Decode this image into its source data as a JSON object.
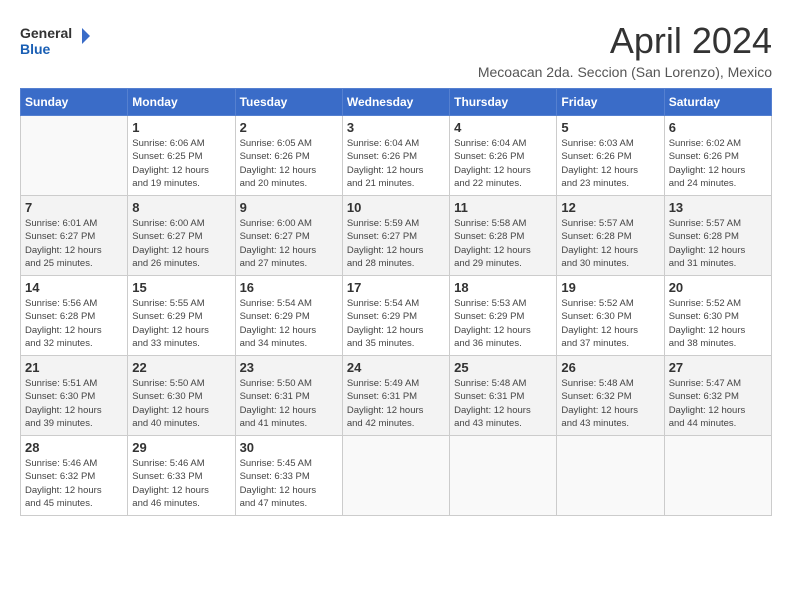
{
  "logo": {
    "line1": "General",
    "line2": "Blue"
  },
  "title": "April 2024",
  "subtitle": "Mecoacan 2da. Seccion (San Lorenzo), Mexico",
  "weekdays": [
    "Sunday",
    "Monday",
    "Tuesday",
    "Wednesday",
    "Thursday",
    "Friday",
    "Saturday"
  ],
  "weeks": [
    [
      {
        "day": "",
        "info": ""
      },
      {
        "day": "1",
        "info": "Sunrise: 6:06 AM\nSunset: 6:25 PM\nDaylight: 12 hours\nand 19 minutes."
      },
      {
        "day": "2",
        "info": "Sunrise: 6:05 AM\nSunset: 6:26 PM\nDaylight: 12 hours\nand 20 minutes."
      },
      {
        "day": "3",
        "info": "Sunrise: 6:04 AM\nSunset: 6:26 PM\nDaylight: 12 hours\nand 21 minutes."
      },
      {
        "day": "4",
        "info": "Sunrise: 6:04 AM\nSunset: 6:26 PM\nDaylight: 12 hours\nand 22 minutes."
      },
      {
        "day": "5",
        "info": "Sunrise: 6:03 AM\nSunset: 6:26 PM\nDaylight: 12 hours\nand 23 minutes."
      },
      {
        "day": "6",
        "info": "Sunrise: 6:02 AM\nSunset: 6:26 PM\nDaylight: 12 hours\nand 24 minutes."
      }
    ],
    [
      {
        "day": "7",
        "info": "Sunrise: 6:01 AM\nSunset: 6:27 PM\nDaylight: 12 hours\nand 25 minutes."
      },
      {
        "day": "8",
        "info": "Sunrise: 6:00 AM\nSunset: 6:27 PM\nDaylight: 12 hours\nand 26 minutes."
      },
      {
        "day": "9",
        "info": "Sunrise: 6:00 AM\nSunset: 6:27 PM\nDaylight: 12 hours\nand 27 minutes."
      },
      {
        "day": "10",
        "info": "Sunrise: 5:59 AM\nSunset: 6:27 PM\nDaylight: 12 hours\nand 28 minutes."
      },
      {
        "day": "11",
        "info": "Sunrise: 5:58 AM\nSunset: 6:28 PM\nDaylight: 12 hours\nand 29 minutes."
      },
      {
        "day": "12",
        "info": "Sunrise: 5:57 AM\nSunset: 6:28 PM\nDaylight: 12 hours\nand 30 minutes."
      },
      {
        "day": "13",
        "info": "Sunrise: 5:57 AM\nSunset: 6:28 PM\nDaylight: 12 hours\nand 31 minutes."
      }
    ],
    [
      {
        "day": "14",
        "info": "Sunrise: 5:56 AM\nSunset: 6:28 PM\nDaylight: 12 hours\nand 32 minutes."
      },
      {
        "day": "15",
        "info": "Sunrise: 5:55 AM\nSunset: 6:29 PM\nDaylight: 12 hours\nand 33 minutes."
      },
      {
        "day": "16",
        "info": "Sunrise: 5:54 AM\nSunset: 6:29 PM\nDaylight: 12 hours\nand 34 minutes."
      },
      {
        "day": "17",
        "info": "Sunrise: 5:54 AM\nSunset: 6:29 PM\nDaylight: 12 hours\nand 35 minutes."
      },
      {
        "day": "18",
        "info": "Sunrise: 5:53 AM\nSunset: 6:29 PM\nDaylight: 12 hours\nand 36 minutes."
      },
      {
        "day": "19",
        "info": "Sunrise: 5:52 AM\nSunset: 6:30 PM\nDaylight: 12 hours\nand 37 minutes."
      },
      {
        "day": "20",
        "info": "Sunrise: 5:52 AM\nSunset: 6:30 PM\nDaylight: 12 hours\nand 38 minutes."
      }
    ],
    [
      {
        "day": "21",
        "info": "Sunrise: 5:51 AM\nSunset: 6:30 PM\nDaylight: 12 hours\nand 39 minutes."
      },
      {
        "day": "22",
        "info": "Sunrise: 5:50 AM\nSunset: 6:30 PM\nDaylight: 12 hours\nand 40 minutes."
      },
      {
        "day": "23",
        "info": "Sunrise: 5:50 AM\nSunset: 6:31 PM\nDaylight: 12 hours\nand 41 minutes."
      },
      {
        "day": "24",
        "info": "Sunrise: 5:49 AM\nSunset: 6:31 PM\nDaylight: 12 hours\nand 42 minutes."
      },
      {
        "day": "25",
        "info": "Sunrise: 5:48 AM\nSunset: 6:31 PM\nDaylight: 12 hours\nand 43 minutes."
      },
      {
        "day": "26",
        "info": "Sunrise: 5:48 AM\nSunset: 6:32 PM\nDaylight: 12 hours\nand 43 minutes."
      },
      {
        "day": "27",
        "info": "Sunrise: 5:47 AM\nSunset: 6:32 PM\nDaylight: 12 hours\nand 44 minutes."
      }
    ],
    [
      {
        "day": "28",
        "info": "Sunrise: 5:46 AM\nSunset: 6:32 PM\nDaylight: 12 hours\nand 45 minutes."
      },
      {
        "day": "29",
        "info": "Sunrise: 5:46 AM\nSunset: 6:33 PM\nDaylight: 12 hours\nand 46 minutes."
      },
      {
        "day": "30",
        "info": "Sunrise: 5:45 AM\nSunset: 6:33 PM\nDaylight: 12 hours\nand 47 minutes."
      },
      {
        "day": "",
        "info": ""
      },
      {
        "day": "",
        "info": ""
      },
      {
        "day": "",
        "info": ""
      },
      {
        "day": "",
        "info": ""
      }
    ]
  ]
}
